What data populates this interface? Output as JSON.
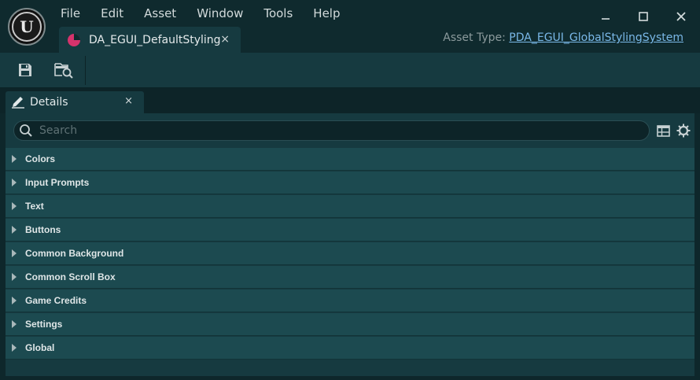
{
  "menu": {
    "items": [
      "File",
      "Edit",
      "Asset",
      "Window",
      "Tools",
      "Help"
    ]
  },
  "asset_tab": {
    "label": "DA_EGUI_DefaultStyling",
    "close": "×",
    "icon": "data-asset-pie-icon"
  },
  "asset_type": {
    "label": "Asset Type:",
    "value": "PDA_EGUI_GlobalStylingSystem"
  },
  "toolbar": {
    "save_icon": "save-icon",
    "browse_icon": "browse-to-asset-icon"
  },
  "details": {
    "tab_label": "Details",
    "tab_close": "×",
    "search_placeholder": "Search",
    "categories": [
      "Colors",
      "Input Prompts",
      "Text",
      "Buttons",
      "Common Background",
      "Common Scroll Box",
      "Game Credits",
      "Settings",
      "Global"
    ]
  },
  "colors": {
    "accent_link": "#7ab8e8",
    "asset_icon": "#d6336c",
    "panel": "#163a40",
    "category_row": "#1c4a50"
  }
}
